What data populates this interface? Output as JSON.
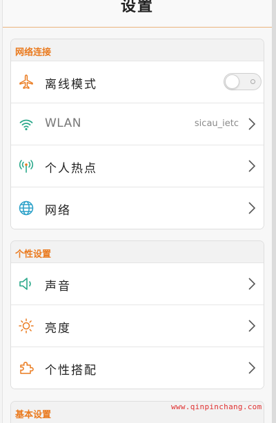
{
  "header": {
    "title": "设置"
  },
  "sections": {
    "network": {
      "title": "网络连接",
      "airplane": {
        "label": "离线模式",
        "icon": "airplane-icon",
        "enabled": false
      },
      "wlan": {
        "label": "WLAN",
        "value": "sicau_ietc",
        "icon": "wifi-icon"
      },
      "hotspot": {
        "label": "个人热点",
        "icon": "hotspot-icon"
      },
      "net": {
        "label": "网络",
        "icon": "globe-icon"
      }
    },
    "personal": {
      "title": "个性设置",
      "sound": {
        "label": "声音",
        "icon": "speaker-icon"
      },
      "brightness": {
        "label": "亮度",
        "icon": "sun-icon"
      },
      "theme": {
        "label": "个性搭配",
        "icon": "puzzle-icon"
      }
    },
    "basic": {
      "title": "基本设置"
    }
  },
  "watermark": "www.qinpinchang.com",
  "colors": {
    "accent": "#ea7a1e",
    "wifi": "#2aa88a",
    "globe": "#2aa0c8"
  }
}
